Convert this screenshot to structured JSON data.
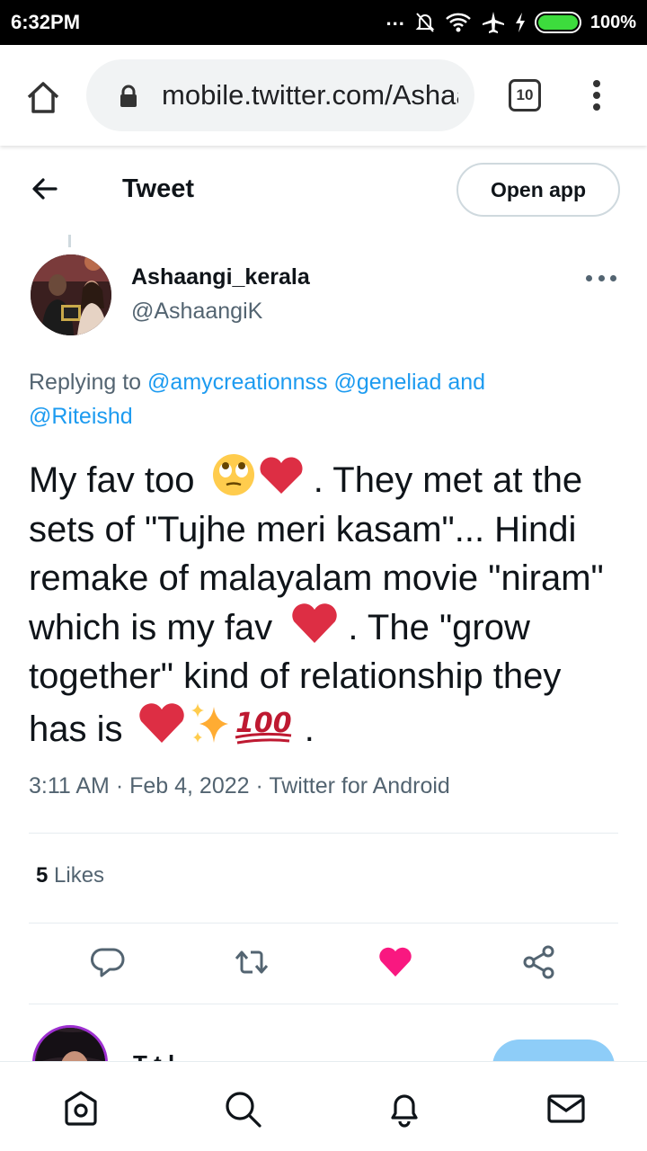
{
  "status_bar": {
    "time": "6:32PM",
    "dots": "...",
    "battery": "100%"
  },
  "browser": {
    "url": "mobile.twitter.com/AshaangiK/status",
    "tab_count": "10"
  },
  "header": {
    "title": "Tweet",
    "open_app_label": "Open app"
  },
  "tweet": {
    "author_name": "Ashaangi_kerala",
    "author_handle": "@AshaangiK",
    "replying_prefix": "Replying to",
    "mention_1": "@amycreationnss",
    "mention_2": "@geneliad",
    "mention_and": "and",
    "mention_3": "@Riteishd",
    "text_1": "My fav too",
    "text_2": ". They met at the sets of \"Tujhe meri kasam\"... Hindi remake of malayalam movie \"niram\" which is my fav",
    "text_3": ". The \"grow together\" kind of relationship they has is",
    "text_4": ".",
    "time": "3:11 AM",
    "date": "Feb 4, 2022",
    "source": "Twitter for Android",
    "separator": "·",
    "likes_count": "5",
    "likes_label": "Likes"
  },
  "next_item": {
    "text": "T         t              l"
  },
  "colors": {
    "accent": "#1d9bf0",
    "like": "#f91880",
    "heart_emoji": "#dd2e44",
    "text_secondary": "#536471"
  },
  "icons": [
    "home-icon",
    "search-icon",
    "notifications-icon",
    "messages-icon",
    "reply-icon",
    "retweet-icon",
    "like-icon",
    "share-icon"
  ]
}
